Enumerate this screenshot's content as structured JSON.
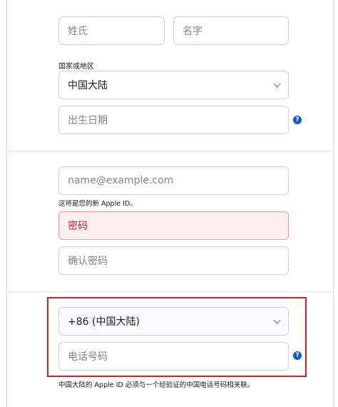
{
  "name": {
    "last_name_placeholder": "姓氏",
    "first_name_placeholder": "名字"
  },
  "region": {
    "label": "国家或地区",
    "selected": "中国大陆"
  },
  "birthday": {
    "placeholder": "出生日期",
    "help_icon": "?"
  },
  "account": {
    "email_placeholder": "name@example.com",
    "email_hint": "这将是您的新 Apple ID。",
    "password_placeholder": "密码",
    "confirm_password_placeholder": "确认密码"
  },
  "phone": {
    "country_code_selected": "+86 (中国大陆)",
    "number_placeholder": "电话号码",
    "help_icon": "?",
    "hint": "中国大陆的 Apple ID 必须与一个经验证的中国电话号码相关联。"
  },
  "colors": {
    "accent": "#0a5fc8",
    "error_bg": "#fff0f0",
    "error_text": "#c0283a",
    "highlight_border": "#d62020"
  },
  "icons": [
    "chevron-down-icon",
    "help-icon"
  ]
}
